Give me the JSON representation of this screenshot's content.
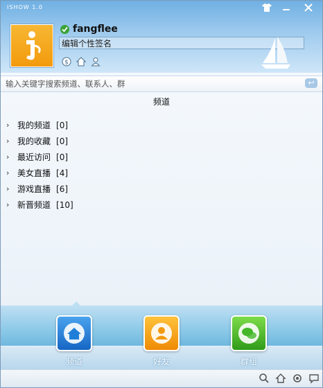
{
  "window": {
    "title": "ISHOW 1.0",
    "controls": [
      "shirt-icon",
      "minimize-icon",
      "close-icon"
    ]
  },
  "profile": {
    "username": "fangflee",
    "signature_placeholder": "编辑个性签名",
    "status_color": "#3aa336"
  },
  "search": {
    "placeholder": "输入关键字搜索频道、联系人、群"
  },
  "channels": {
    "heading": "频道",
    "items": [
      {
        "label": "我的频道",
        "count": "[0]"
      },
      {
        "label": "我的收藏",
        "count": "[0]"
      },
      {
        "label": "最近访问",
        "count": "[0]"
      },
      {
        "label": "美女直播",
        "count": "[4]"
      },
      {
        "label": "游戏直播",
        "count": "[6]"
      },
      {
        "label": "新晋频道",
        "count": "[10]"
      }
    ]
  },
  "tabs": [
    {
      "label": "频道",
      "icon": "home-icon",
      "color": "#1f7fd8",
      "active": true
    },
    {
      "label": "好友",
      "icon": "friend-icon",
      "color": "#f29a12",
      "active": false
    },
    {
      "label": "群组",
      "icon": "group-chat-icon",
      "color": "#45b82a",
      "active": false
    }
  ],
  "colors": {
    "header_top": "#6fb0e3",
    "avatar": "#f7a823"
  }
}
